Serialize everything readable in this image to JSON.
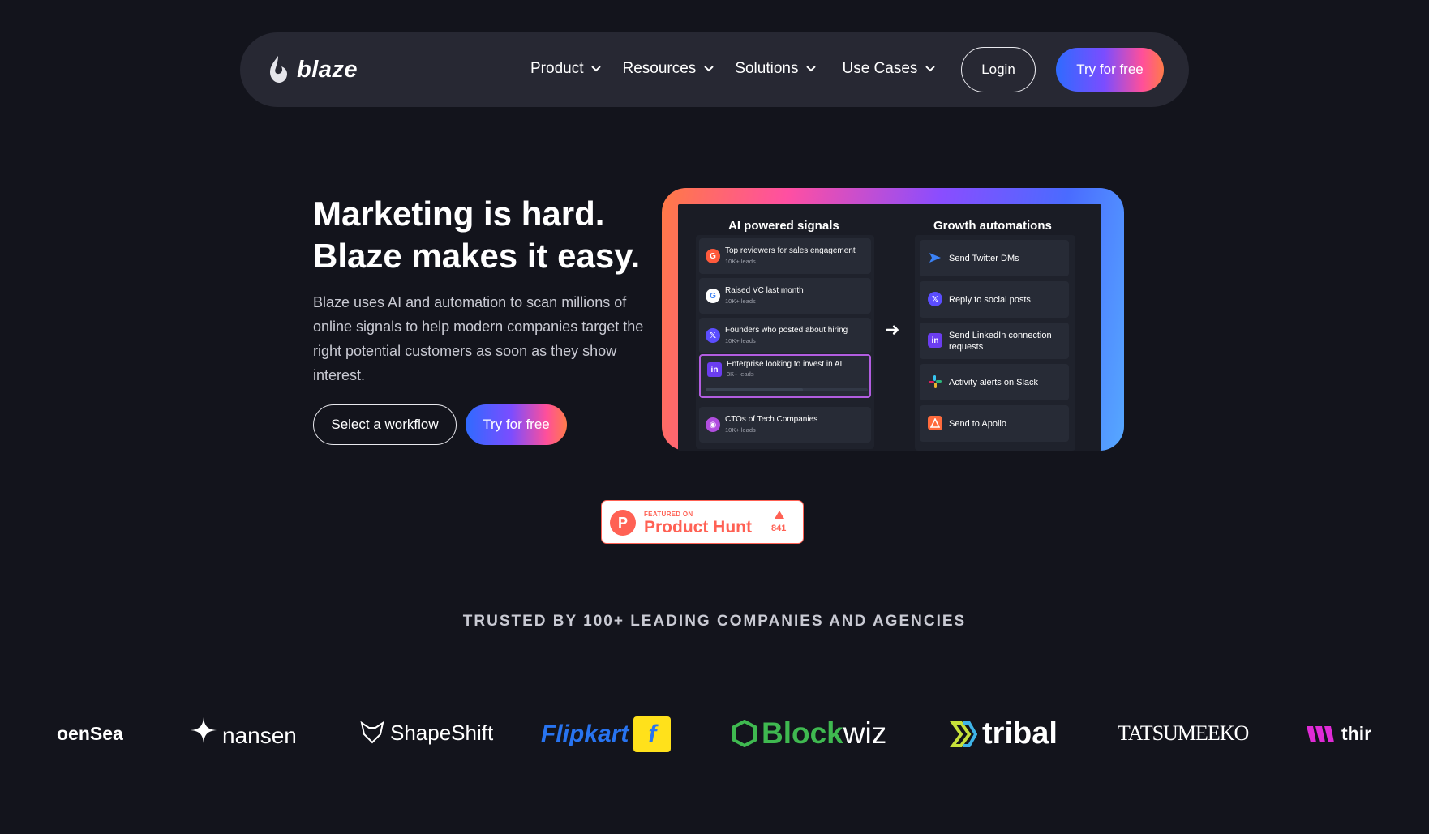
{
  "nav": {
    "brand": "blaze",
    "links": [
      {
        "label": "Product"
      },
      {
        "label": "Resources"
      },
      {
        "label": "Solutions"
      },
      {
        "label": "Use Cases"
      }
    ],
    "login_label": "Login",
    "try_label": "Try for free"
  },
  "hero": {
    "title_line1": "Marketing is hard.",
    "title_line2": "Blaze makes it easy.",
    "description": "Blaze uses AI and automation to scan millions of online signals to help modern companies target the right potential customers as soon as they show interest.",
    "select_workflow_label": "Select a workflow",
    "try_label": "Try for free"
  },
  "preview": {
    "signals_title": "AI powered signals",
    "automations_title": "Growth automations",
    "signals": [
      {
        "title": "Top reviewers for sales engagement",
        "sub": "10K+ leads",
        "icon": "g2-icon",
        "color": "#ff5a3c"
      },
      {
        "title": "Raised VC last month",
        "sub": "10K+ leads",
        "icon": "google-icon",
        "color": "#ffffff"
      },
      {
        "title": "Founders who posted about hiring",
        "sub": "10K+ leads",
        "icon": "x-icon",
        "color": "#5b4dff"
      },
      {
        "title": "Enterprise looking to invest in AI",
        "sub": "3K+ leads",
        "icon": "linkedin-icon",
        "color": "#6b3df0"
      },
      {
        "title": "CTOs of Tech Companies",
        "sub": "10K+ leads",
        "icon": "github-icon",
        "color": "#b14ee0"
      }
    ],
    "automations": [
      {
        "label": "Send Twitter DMs",
        "icon": "send-icon",
        "color": "#3b82f6"
      },
      {
        "label": "Reply to social posts",
        "icon": "x-icon",
        "color": "#5b4dff"
      },
      {
        "label": "Send LinkedIn connection requests",
        "icon": "linkedin-icon",
        "color": "#6b3df0"
      },
      {
        "label": "Activity alerts on Slack",
        "icon": "slack-icon",
        "color": "#e01e5a"
      },
      {
        "label": "Send to Apollo",
        "icon": "apollo-icon",
        "color": "#ff6b3d"
      }
    ]
  },
  "product_hunt": {
    "featured": "FEATURED ON",
    "name": "Product Hunt",
    "count": "841"
  },
  "trusted": {
    "heading": "TRUSTED BY 100+ LEADING COMPANIES AND AGENCIES",
    "logos": [
      {
        "name": "OpenSea",
        "text": "oenSea"
      },
      {
        "name": "nansen",
        "text": "nansen"
      },
      {
        "name": "ShapeShift",
        "text": "ShapeShift"
      },
      {
        "name": "Flipkart",
        "text": "Flipkart"
      },
      {
        "name": "Blockwiz",
        "text_a": "Block",
        "text_b": "wiz"
      },
      {
        "name": "tribal",
        "text": "tribal"
      },
      {
        "name": "Tatsumeeko",
        "text": "TATSUMEEKO"
      },
      {
        "name": "thirdweb",
        "text": "thir"
      }
    ]
  },
  "colors": {
    "background": "#13141c",
    "nav_bg": "#272833",
    "accent_blue": "#2f6bff",
    "accent_pink": "#ff4f9a",
    "product_hunt": "#ff6154"
  }
}
